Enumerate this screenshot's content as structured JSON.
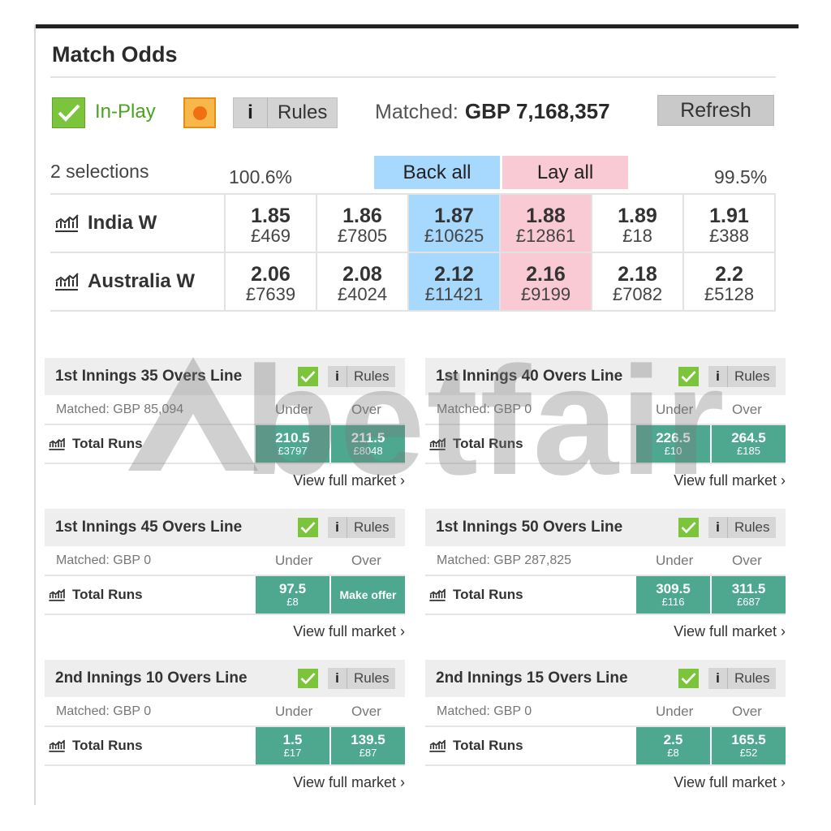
{
  "market": {
    "title": "Match Odds",
    "inplay_label": "In-Play",
    "info_label": "i",
    "rules_label": "Rules",
    "matched_label": "Matched:",
    "matched_value": "GBP 7,168,357",
    "refresh_label": "Refresh",
    "selections_label": "2 selections",
    "back_pct": "100.6%",
    "lay_pct": "99.5%",
    "back_all_label": "Back all",
    "lay_all_label": "Lay all",
    "runners": [
      {
        "name": "India W",
        "cells": [
          {
            "price": "1.85",
            "size": "£469"
          },
          {
            "price": "1.86",
            "size": "£7805"
          },
          {
            "price": "1.87",
            "size": "£10625"
          },
          {
            "price": "1.88",
            "size": "£12861"
          },
          {
            "price": "1.89",
            "size": "£18"
          },
          {
            "price": "1.91",
            "size": "£388"
          }
        ]
      },
      {
        "name": "Australia W",
        "cells": [
          {
            "price": "2.06",
            "size": "£7639"
          },
          {
            "price": "2.08",
            "size": "£4024"
          },
          {
            "price": "2.12",
            "size": "£11421"
          },
          {
            "price": "2.16",
            "size": "£9199"
          },
          {
            "price": "2.18",
            "size": "£7082"
          },
          {
            "price": "2.2",
            "size": "£5128"
          }
        ]
      }
    ]
  },
  "watermark": "betfair",
  "panels": [
    {
      "title": "1st Innings 35 Overs Line",
      "matched": "Matched: GBP 85,094",
      "under_label": "Under",
      "over_label": "Over",
      "runner": "Total Runs",
      "under_price": "210.5",
      "under_size": "£3797",
      "over_price": "211.5",
      "over_size": "£8048",
      "over_offer": "",
      "link": "View full market ›",
      "info_label": "i",
      "rules_label": "Rules"
    },
    {
      "title": "1st Innings 40 Overs Line",
      "matched": "Matched: GBP 0",
      "under_label": "Under",
      "over_label": "Over",
      "runner": "Total Runs",
      "under_price": "226.5",
      "under_size": "£10",
      "over_price": "264.5",
      "over_size": "£185",
      "over_offer": "",
      "link": "View full market ›",
      "info_label": "i",
      "rules_label": "Rules"
    },
    {
      "title": "1st Innings 45 Overs Line",
      "matched": "Matched: GBP 0",
      "under_label": "Under",
      "over_label": "Over",
      "runner": "Total Runs",
      "under_price": "97.5",
      "under_size": "£8",
      "over_price": "",
      "over_size": "",
      "over_offer": "Make offer",
      "link": "View full market ›",
      "info_label": "i",
      "rules_label": "Rules"
    },
    {
      "title": "1st Innings 50 Overs Line",
      "matched": "Matched: GBP 287,825",
      "under_label": "Under",
      "over_label": "Over",
      "runner": "Total Runs",
      "under_price": "309.5",
      "under_size": "£116",
      "over_price": "311.5",
      "over_size": "£687",
      "over_offer": "",
      "link": "View full market ›",
      "info_label": "i",
      "rules_label": "Rules"
    },
    {
      "title": "2nd Innings 10 Overs Line",
      "matched": "Matched: GBP 0",
      "under_label": "Under",
      "over_label": "Over",
      "runner": "Total Runs",
      "under_price": "1.5",
      "under_size": "£17",
      "over_price": "139.5",
      "over_size": "£87",
      "over_offer": "",
      "link": "View full market ›",
      "info_label": "i",
      "rules_label": "Rules"
    },
    {
      "title": "2nd Innings 15 Overs Line",
      "matched": "Matched: GBP 0",
      "under_label": "Under",
      "over_label": "Over",
      "runner": "Total Runs",
      "under_price": "2.5",
      "under_size": "£8",
      "over_price": "165.5",
      "over_size": "£52",
      "over_offer": "",
      "link": "View full market ›",
      "info_label": "i",
      "rules_label": "Rules"
    }
  ],
  "colors": {
    "back": "#a7d8fd",
    "lay": "#f9c9d4",
    "line_cell": "#4ea88f",
    "inplay_green": "#7cc43c"
  }
}
